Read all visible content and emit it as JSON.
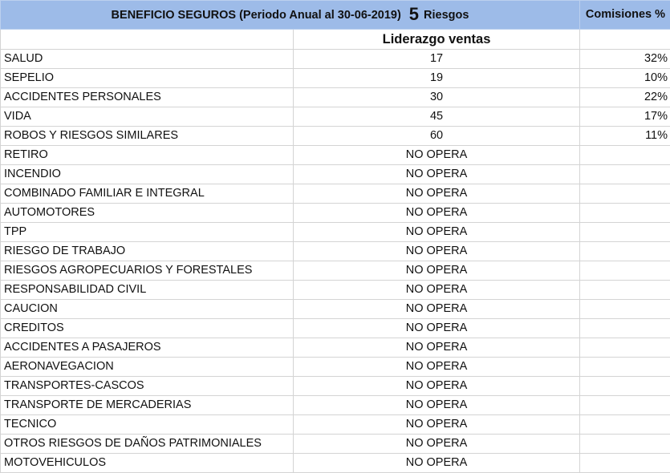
{
  "header": {
    "title": "BENEFICIO SEGUROS (Periodo Anual al 30-06-2019)",
    "risk_count": "5",
    "risk_unit": "Riesgos",
    "commissions_label": "Comisiones %"
  },
  "subheader": {
    "label": "Liderazgo ventas"
  },
  "rows": [
    {
      "risk": "SALUD",
      "value": "17",
      "commission": "32%"
    },
    {
      "risk": "SEPELIO",
      "value": "19",
      "commission": "10%"
    },
    {
      "risk": "ACCIDENTES PERSONALES",
      "value": "30",
      "commission": "22%"
    },
    {
      "risk": "VIDA",
      "value": "45",
      "commission": "17%"
    },
    {
      "risk": "ROBOS Y RIESGOS SIMILARES",
      "value": "60",
      "commission": "11%"
    },
    {
      "risk": "RETIRO",
      "value": "NO OPERA",
      "commission": ""
    },
    {
      "risk": "INCENDIO",
      "value": "NO OPERA",
      "commission": ""
    },
    {
      "risk": "COMBINADO FAMILIAR E INTEGRAL",
      "value": "NO OPERA",
      "commission": ""
    },
    {
      "risk": "AUTOMOTORES",
      "value": "NO OPERA",
      "commission": ""
    },
    {
      "risk": "TPP",
      "value": "NO OPERA",
      "commission": ""
    },
    {
      "risk": "RIESGO DE TRABAJO",
      "value": "NO OPERA",
      "commission": ""
    },
    {
      "risk": "RIESGOS AGROPECUARIOS Y FORESTALES",
      "value": "NO OPERA",
      "commission": ""
    },
    {
      "risk": "RESPONSABILIDAD CIVIL",
      "value": "NO OPERA",
      "commission": ""
    },
    {
      "risk": "CAUCION",
      "value": "NO OPERA",
      "commission": ""
    },
    {
      "risk": "CREDITOS",
      "value": "NO OPERA",
      "commission": ""
    },
    {
      "risk": "ACCIDENTES A PASAJEROS",
      "value": "NO OPERA",
      "commission": ""
    },
    {
      "risk": "AERONAVEGACION",
      "value": "NO OPERA",
      "commission": ""
    },
    {
      "risk": "TRANSPORTES-CASCOS",
      "value": "NO OPERA",
      "commission": ""
    },
    {
      "risk": "TRANSPORTE DE MERCADERIAS",
      "value": "NO OPERA",
      "commission": ""
    },
    {
      "risk": "TECNICO",
      "value": "NO OPERA",
      "commission": ""
    },
    {
      "risk": "OTROS RIESGOS DE DAÑOS PATRIMONIALES",
      "value": "NO OPERA",
      "commission": ""
    },
    {
      "risk": "MOTOVEHICULOS",
      "value": "NO OPERA",
      "commission": ""
    }
  ],
  "colors": {
    "header_background": "#9dbbe8",
    "gridline": "#d4d4d4"
  }
}
